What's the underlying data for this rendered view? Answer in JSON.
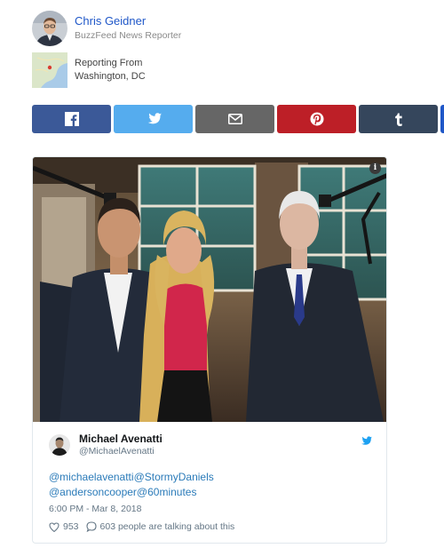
{
  "author": {
    "name": "Chris Geidner",
    "title": "BuzzFeed News Reporter"
  },
  "location": {
    "label": "Reporting From",
    "place": "Washington, DC"
  },
  "share": {
    "buttons": [
      "facebook-icon",
      "twitter-icon",
      "email-icon",
      "pinterest-icon",
      "tumblr-icon"
    ],
    "colors": {
      "facebook": "#3b5998",
      "twitter": "#55acee",
      "email": "#666666",
      "pinterest": "#bd1f27",
      "tumblr": "#35465c"
    }
  },
  "tweet": {
    "name": "Michael Avenatti",
    "handle": "@MichaelAvenatti",
    "mentions": [
      "@michaelavenatti",
      "@StormyDaniels",
      "@andersoncooper",
      "@60minutes"
    ],
    "timestamp": "6:00 PM - Mar 8, 2018",
    "likes": "953",
    "talking": "603 people are talking about this",
    "link_color": "#2b7bb9"
  }
}
